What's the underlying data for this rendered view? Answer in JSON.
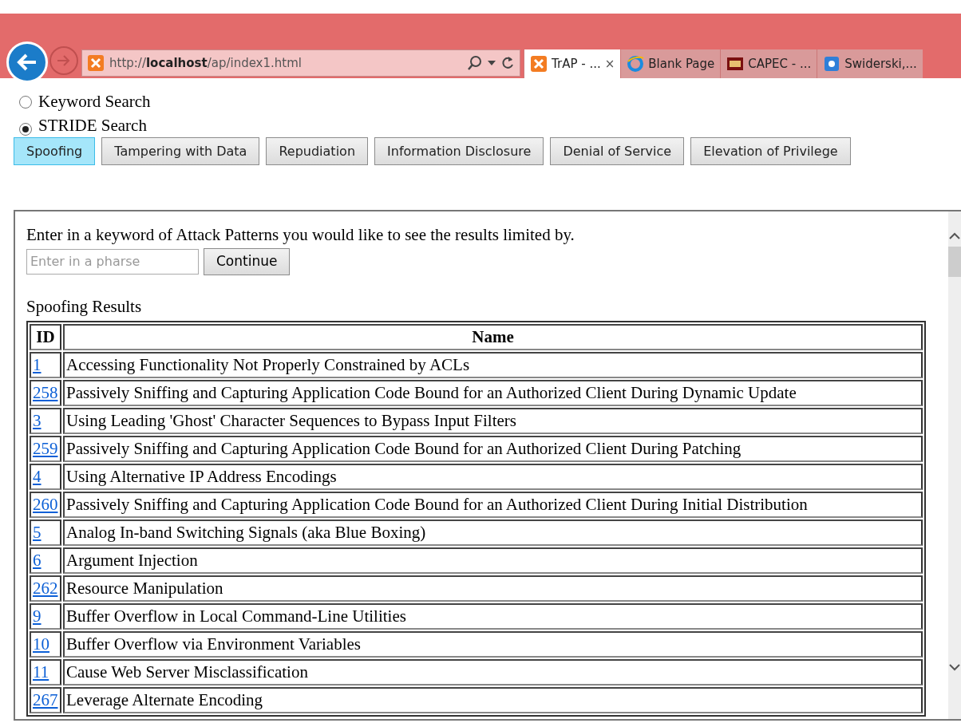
{
  "browser": {
    "address": "http://**localhost**/ap/index1.html",
    "tabs": [
      {
        "title": "TrAP - ...",
        "selected": true,
        "close": "×"
      },
      {
        "title": "Blank Page",
        "selected": false
      },
      {
        "title": "CAPEC - ...",
        "selected": false
      },
      {
        "title": "Swiderski,...",
        "selected": false
      }
    ]
  },
  "search_mode": [
    {
      "label": "Keyword Search",
      "selected": false
    },
    {
      "label": "STRIDE Search",
      "selected": true
    }
  ],
  "stride_buttons": [
    {
      "label": "Spoofing",
      "selected": true
    },
    {
      "label": "Tampering with Data",
      "selected": false
    },
    {
      "label": "Repudiation",
      "selected": false
    },
    {
      "label": "Information Disclosure",
      "selected": false
    },
    {
      "label": "Denial of Service",
      "selected": false
    },
    {
      "label": "Elevation of Privilege",
      "selected": false
    }
  ],
  "frame": {
    "prompt": "Enter in a keyword of Attack Patterns you would like to see the results limited by.",
    "placeholder": "Enter in a pharse",
    "button": "Continue",
    "results_title": "Spoofing Results",
    "table": {
      "columns": [
        "ID",
        "Name"
      ],
      "rows": [
        {
          "id": "1",
          "name": "Accessing Functionality Not Properly Constrained by ACLs"
        },
        {
          "id": "258",
          "name": "Passively Sniffing and Capturing Application Code Bound for an Authorized Client During Dynamic Update"
        },
        {
          "id": "3",
          "name": "Using Leading 'Ghost' Character Sequences to Bypass Input Filters"
        },
        {
          "id": "259",
          "name": "Passively Sniffing and Capturing Application Code Bound for an Authorized Client During Patching"
        },
        {
          "id": "4",
          "name": "Using Alternative IP Address Encodings"
        },
        {
          "id": "260",
          "name": "Passively Sniffing and Capturing Application Code Bound for an Authorized Client During Initial Distribution"
        },
        {
          "id": "5",
          "name": "Analog In-band Switching Signals (aka Blue Boxing)"
        },
        {
          "id": "6",
          "name": "Argument Injection"
        },
        {
          "id": "262",
          "name": "Resource Manipulation"
        },
        {
          "id": "9",
          "name": "Buffer Overflow in Local Command-Line Utilities"
        },
        {
          "id": "10",
          "name": "Buffer Overflow via Environment Variables"
        },
        {
          "id": "11",
          "name": "Cause Web Server Misclassification"
        },
        {
          "id": "267",
          "name": "Leverage Alternate Encoding"
        }
      ]
    }
  }
}
